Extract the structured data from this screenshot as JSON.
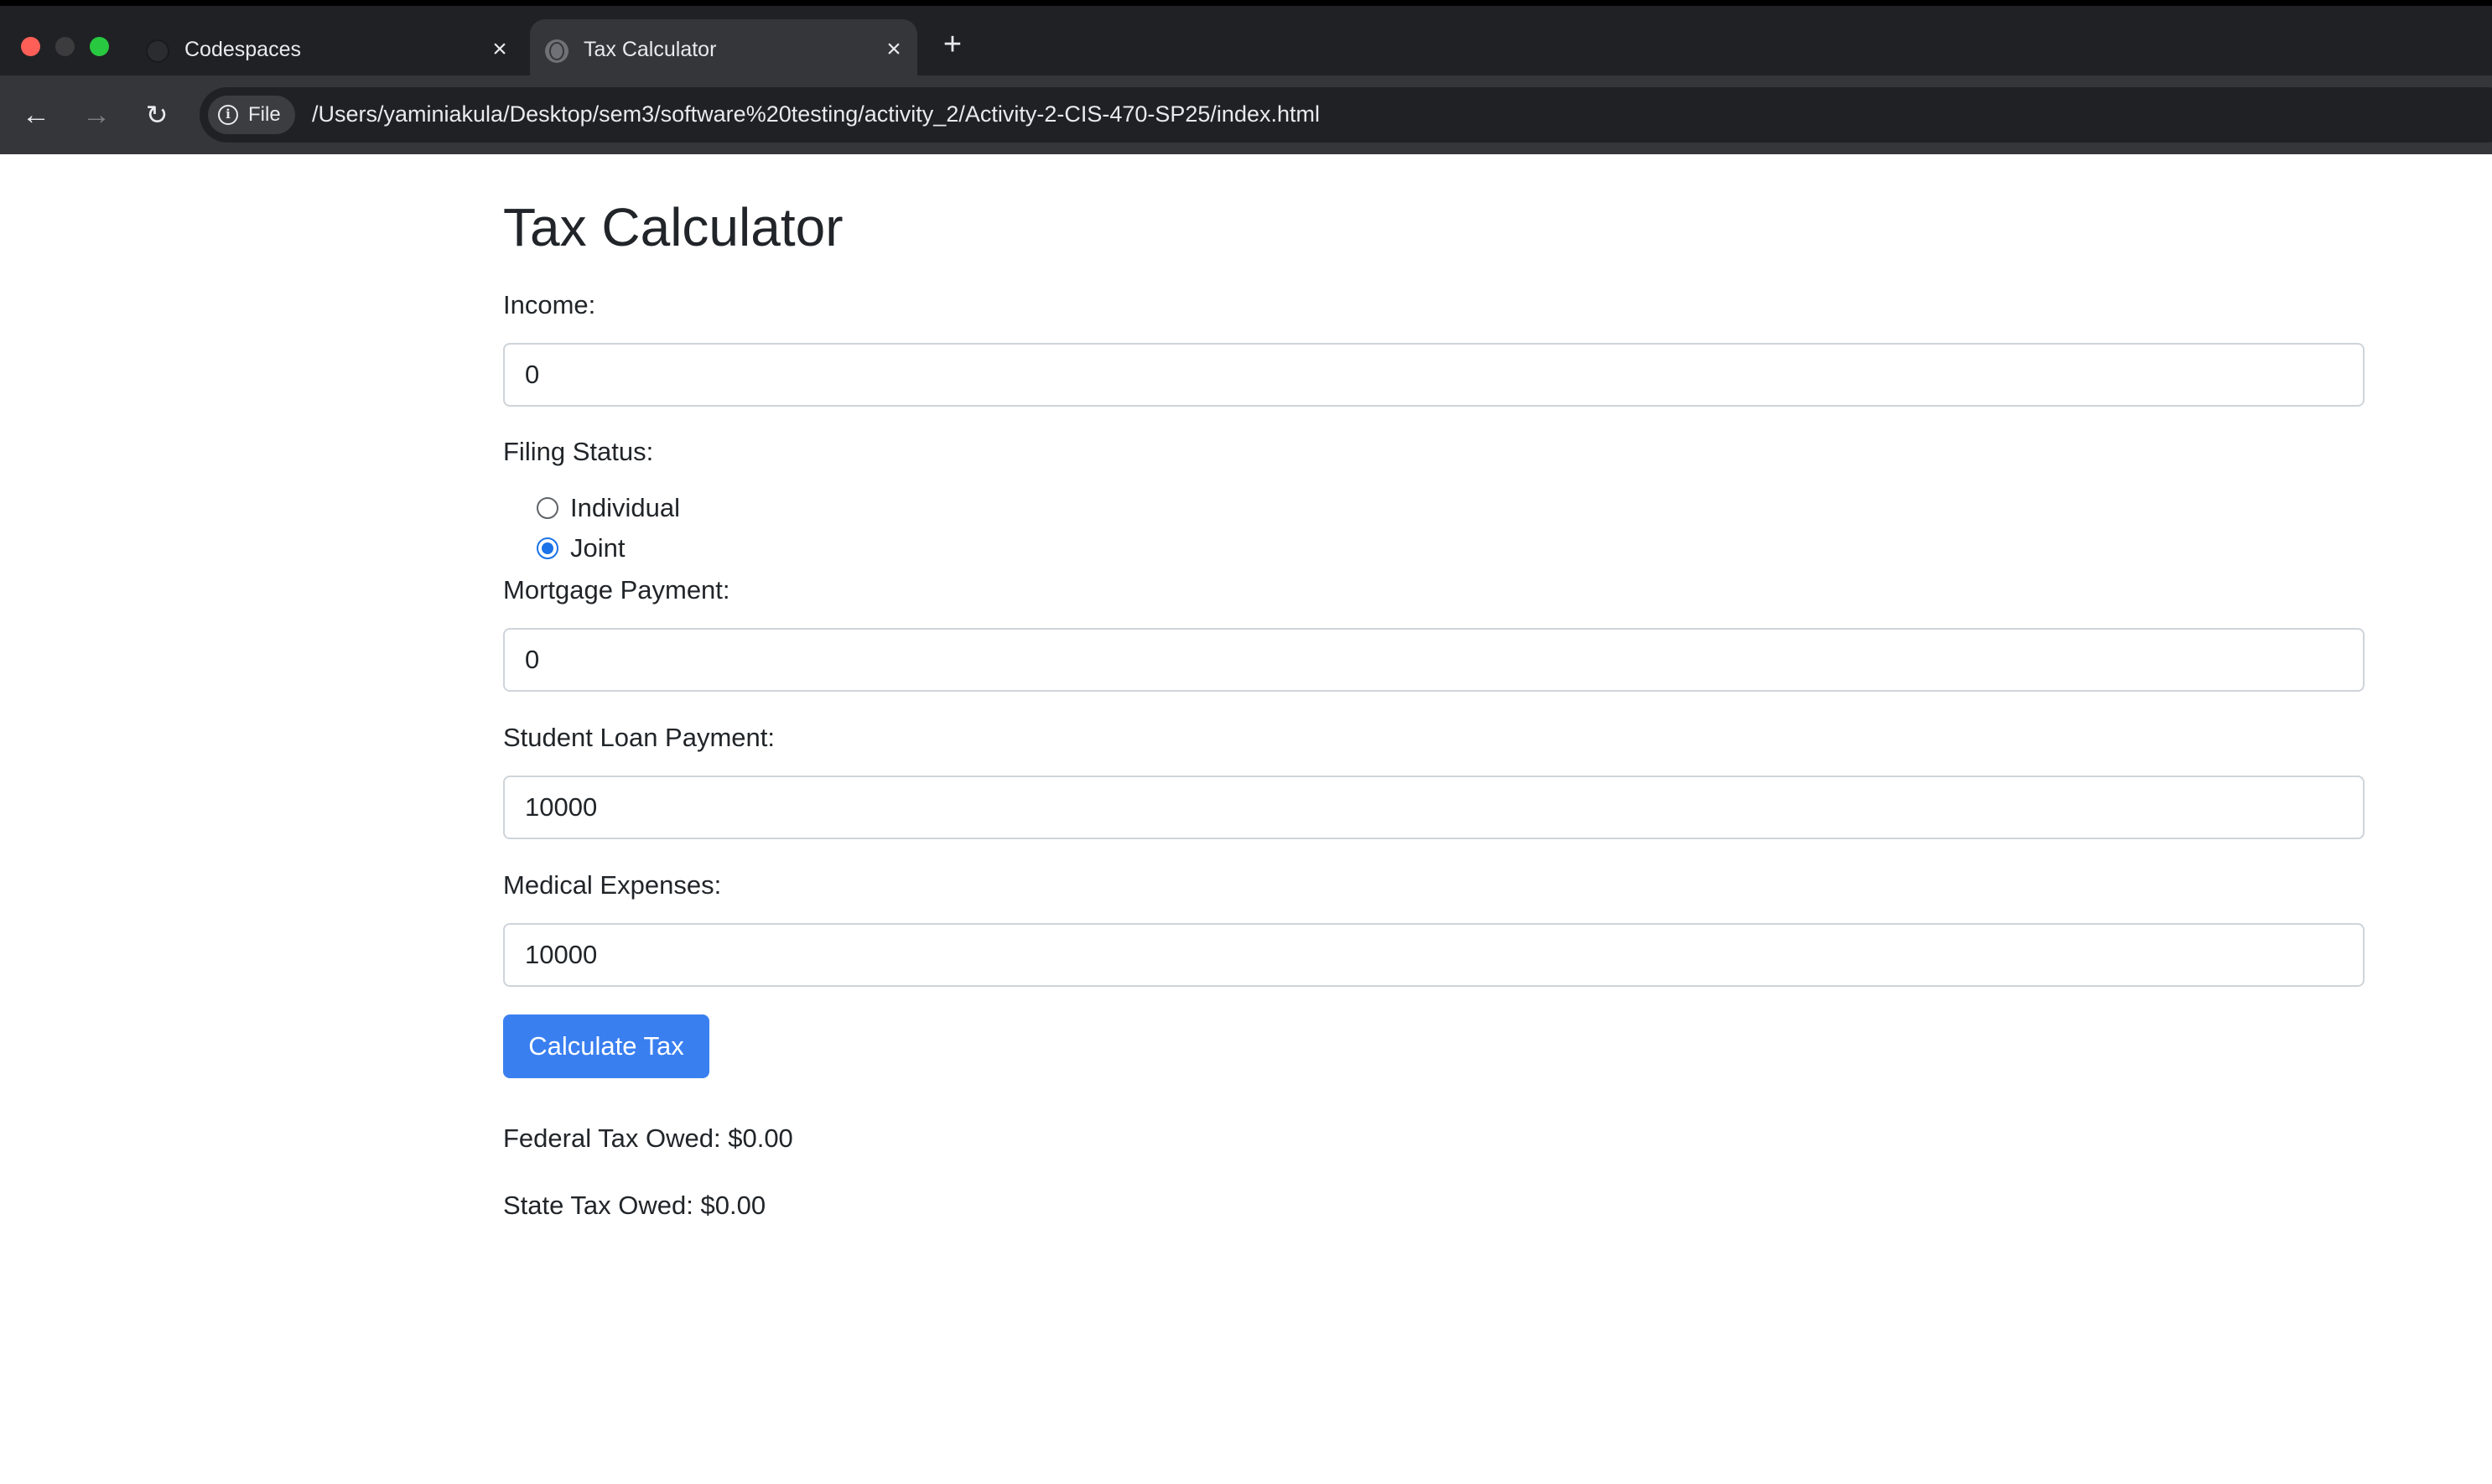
{
  "browser": {
    "tabs": [
      {
        "title": "Codespaces",
        "active": false,
        "icon": "github-icon"
      },
      {
        "title": "Tax Calculator",
        "active": true,
        "icon": "globe-icon"
      }
    ],
    "chip_label": "File",
    "url": "/Users/yaminiakula/Desktop/sem3/software%20testing/activity_2/Activity-2-CIS-470-SP25/index.html"
  },
  "page": {
    "heading": "Tax Calculator",
    "income": {
      "label": "Income:",
      "value": "0"
    },
    "filing_status": {
      "label": "Filing Status:",
      "options": [
        {
          "label": "Individual",
          "checked": false
        },
        {
          "label": "Joint",
          "checked": true
        }
      ]
    },
    "mortgage": {
      "label": "Mortgage Payment:",
      "value": "0"
    },
    "student_loan": {
      "label": "Student Loan Payment:",
      "value": "10000"
    },
    "medical": {
      "label": "Medical Expenses:",
      "value": "10000"
    },
    "calculate_label": "Calculate Tax",
    "federal_result": "Federal Tax Owed: $0.00",
    "state_result": "State Tax Owed: $0.00"
  },
  "colors": {
    "primary_button": "#3a7ff0",
    "radio_checked": "#1a73e8",
    "chrome_dark": "#202124"
  }
}
